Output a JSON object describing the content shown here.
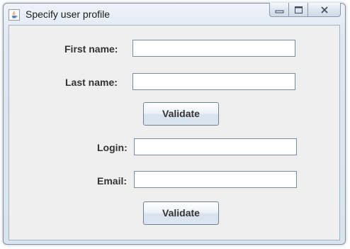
{
  "window": {
    "title": "Specify user profile",
    "app_icon": "java-cup-icon",
    "controls": [
      "minimize-icon",
      "maximize-icon",
      "close-icon"
    ]
  },
  "form": {
    "first_name": {
      "label": "First name:",
      "value": ""
    },
    "last_name": {
      "label": "Last name:",
      "value": ""
    },
    "validate_1": {
      "label": "Validate"
    },
    "login": {
      "label": "Login:",
      "value": ""
    },
    "email": {
      "label": "Email:",
      "value": ""
    },
    "validate_2": {
      "label": "Validate"
    }
  },
  "colors": {
    "panel_background": "#efefef",
    "field_border": "#7a8a9f",
    "title_bar": "#dfe8f3"
  }
}
